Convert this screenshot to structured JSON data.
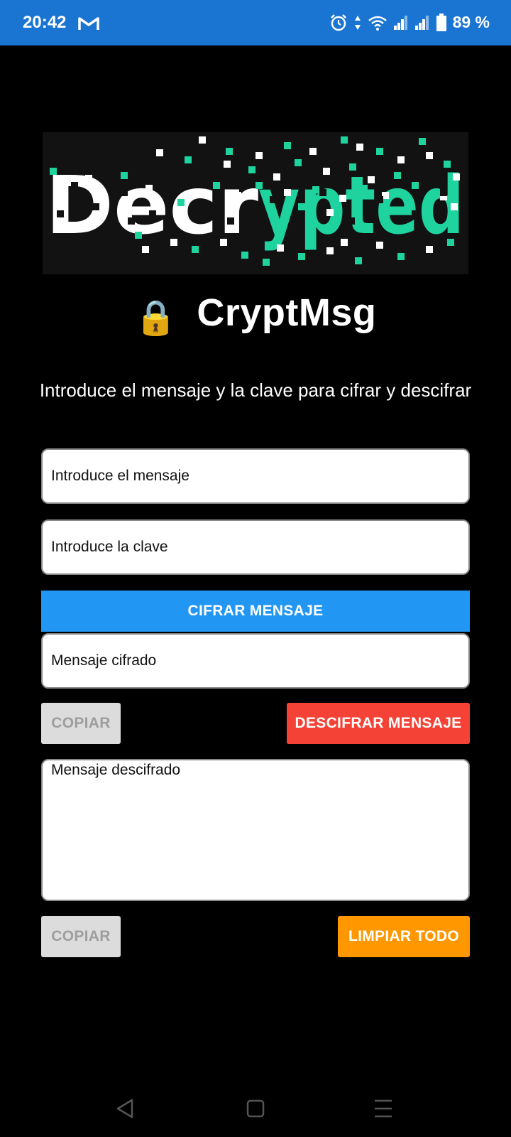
{
  "status_bar": {
    "time": "20:42",
    "battery": "89 %",
    "icons": [
      "gmail-icon",
      "alarm-icon",
      "data-arrows-icon",
      "wifi-icon",
      "signal-icon",
      "signal-icon-2",
      "battery-icon"
    ]
  },
  "hero": {
    "text": "Decrypted",
    "accent_color": "#1fd39f"
  },
  "app": {
    "lock_icon": "🔒",
    "title": "CryptMsg"
  },
  "subtitle": "Introduce el mensaje y la clave para cifrar y descifrar",
  "fields": {
    "message_placeholder": "Introduce el mensaje",
    "key_placeholder": "Introduce la clave",
    "encrypted_placeholder": "Mensaje cifrado",
    "decrypted_placeholder": "Mensaje descifrado"
  },
  "buttons": {
    "encrypt": "CIFRAR MENSAJE",
    "copy_1": "COPIAR",
    "decrypt": "DESCIFRAR MENSAJE",
    "copy_2": "COPIAR",
    "clear_all": "LIMPIAR TODO"
  },
  "colors": {
    "status_bar": "#1a74d2",
    "encrypt_button": "#2196f3",
    "decrypt_button": "#f44336",
    "clear_button": "#ff9800",
    "copy_button": "#dcdcdc"
  },
  "nav_bar": {
    "icons": [
      "back-icon",
      "home-icon",
      "menu-icon"
    ]
  }
}
